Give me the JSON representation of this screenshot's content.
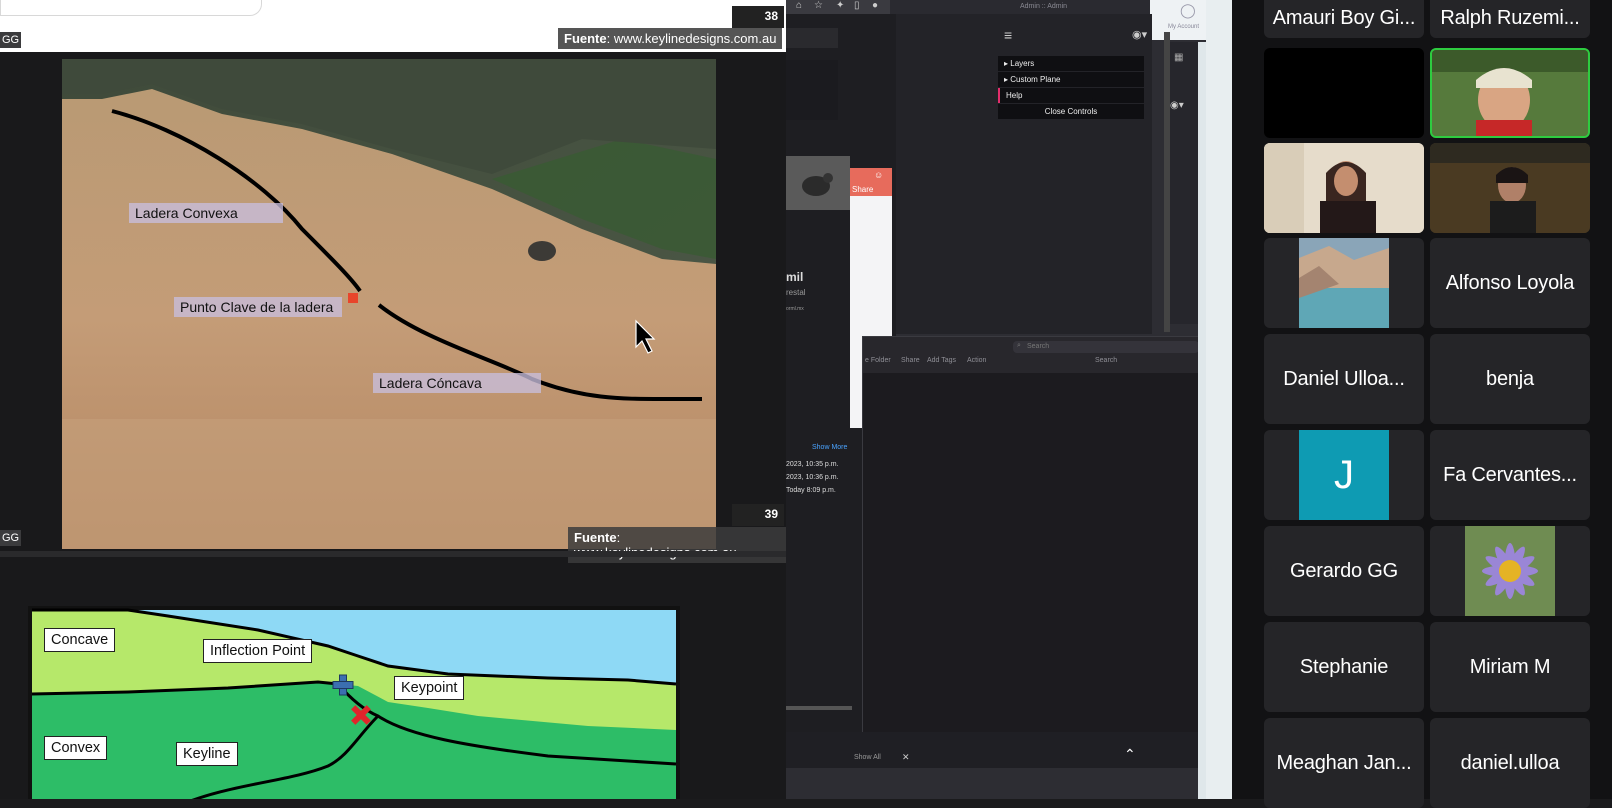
{
  "slides": {
    "slide38": {
      "page_number": "38",
      "source_label": "Fuente",
      "source_url": ": www.keylinedesigns.com.au",
      "corner_tag": "GG"
    },
    "slide39": {
      "page_number": "39",
      "source_label": "Fuente",
      "source_url": ": www.keylinedesigns.com.au",
      "corner_tag": "GG",
      "labels": {
        "convex": "Ladera Convexa",
        "keypoint": "Punto Clave de la ladera",
        "concave": "Ladera Cóncava"
      }
    },
    "diagram": {
      "labels": {
        "concave": "Concave",
        "inflection": "Inflection Point",
        "keypoint": "Keypoint",
        "convex": "Convex",
        "keyline": "Keyline"
      }
    }
  },
  "middle": {
    "top_title": "Admin :: Admin",
    "my_account": "My Account",
    "menu": {
      "layers": "Layers",
      "custom_plane": "Custom Plane",
      "help": "Help",
      "close_controls": "Close Controls"
    },
    "share_label": "Share",
    "brand_text": "mil",
    "brand_sub": "restal",
    "brand_url": "orml.mx",
    "show_more": "Show More",
    "dates": [
      "2023, 10:35 p.m.",
      "2023, 10:36 p.m.",
      "Today 8:09 p.m."
    ],
    "finder": {
      "folder": "e Folder",
      "share": "Share",
      "add_tags": "Add Tags",
      "action": "Action",
      "search_placeholder": "Search",
      "search_label": "Search"
    },
    "show_all": "Show All",
    "close": "✕"
  },
  "participants": {
    "top_partial": [
      "Amauri Boy Gi...",
      "Ralph Ruzemi..."
    ],
    "names": {
      "alfonso": "Alfonso Loyola",
      "daniel": "Daniel Ulloa...",
      "benja": "benja",
      "j_initial": "J",
      "fa": "Fa Cervantes...",
      "gerardo": "Gerardo GG",
      "stephanie": "Stephanie",
      "miriam": "Miriam M",
      "meaghan": "Meaghan Jan...",
      "danielulloa": "daniel.ulloa"
    },
    "j_tile_color": "#0e9bb3",
    "active_speaker_color": "#2ecc40"
  }
}
